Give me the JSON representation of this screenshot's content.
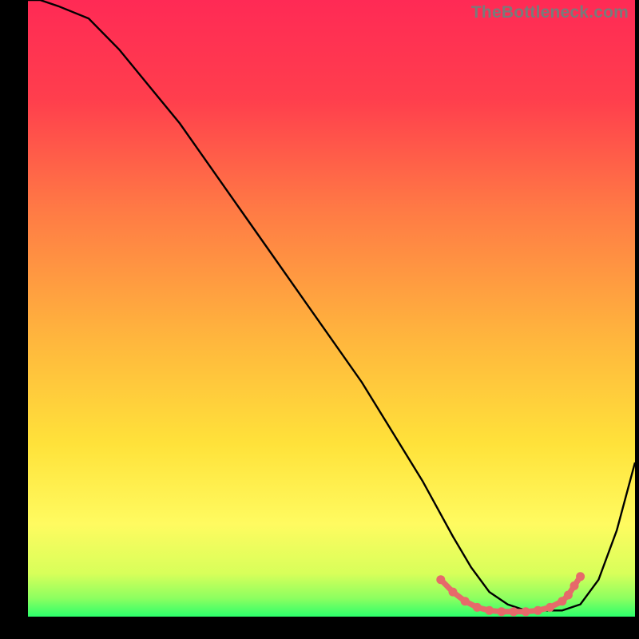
{
  "watermark": "TheBottleneck.com",
  "accent_color": "#e66a6a",
  "chart_data": {
    "type": "line",
    "title": "",
    "xlabel": "",
    "ylabel": "",
    "xlim": [
      0,
      100
    ],
    "ylim": [
      0,
      100
    ],
    "grid": false,
    "legend": false,
    "background_gradient": [
      "#ff2a55",
      "#ff7a45",
      "#ffd33a",
      "#fffb60",
      "#2cff6b"
    ],
    "series": [
      {
        "name": "bottleneck-curve",
        "x": [
          0,
          2,
          5,
          10,
          15,
          20,
          25,
          30,
          35,
          40,
          45,
          50,
          55,
          60,
          65,
          70,
          73,
          76,
          79,
          82,
          85,
          88,
          91,
          94,
          97,
          100
        ],
        "values": [
          100,
          100,
          99,
          97,
          92,
          86,
          80,
          73,
          66,
          59,
          52,
          45,
          38,
          30,
          22,
          13,
          8,
          4,
          2,
          1,
          1,
          1,
          2,
          6,
          14,
          25
        ]
      }
    ],
    "highlight_points": {
      "name": "trough-markers",
      "x": [
        68,
        70,
        72,
        74,
        76,
        78,
        80,
        82,
        84,
        86,
        88,
        89,
        90,
        91
      ],
      "values": [
        6.0,
        4.0,
        2.5,
        1.5,
        1.0,
        0.8,
        0.8,
        0.8,
        1.0,
        1.5,
        2.5,
        3.5,
        5.0,
        6.5
      ]
    }
  }
}
